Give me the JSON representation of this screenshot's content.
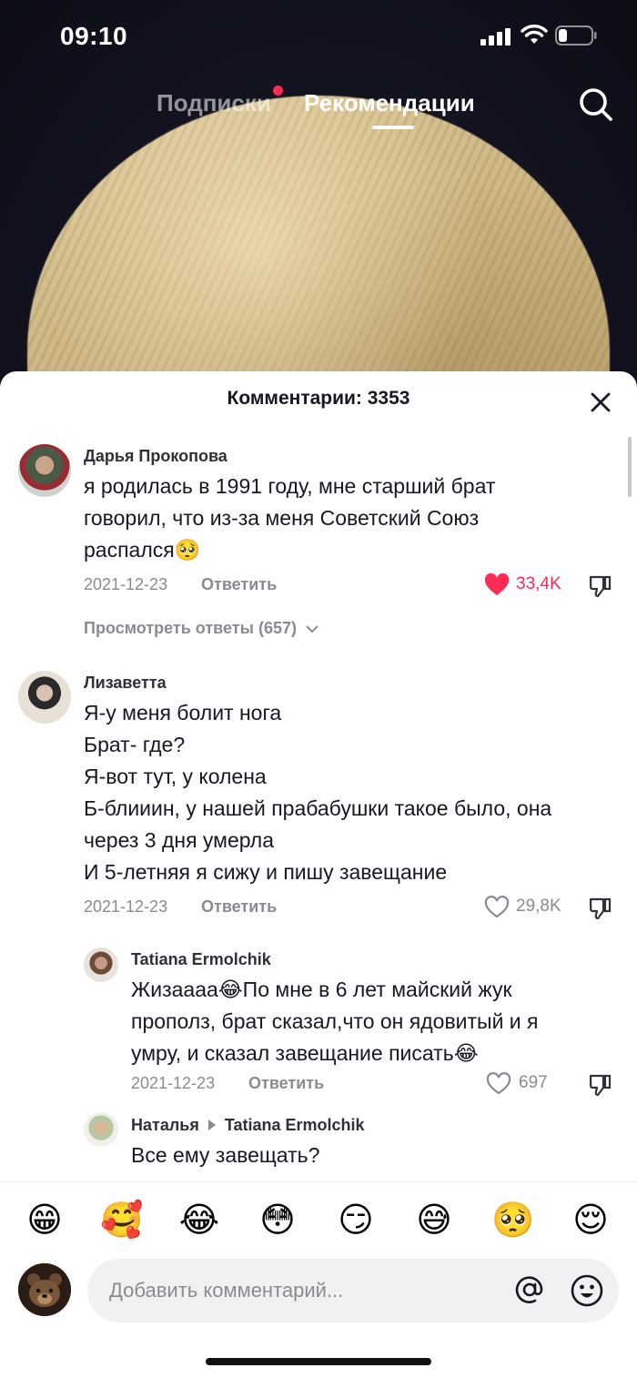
{
  "status_bar": {
    "time": "09:10"
  },
  "top_tabs": {
    "following": "Подписки",
    "for_you": "Рекомендации"
  },
  "sheet": {
    "title": "Комментарии: 3353"
  },
  "comments": [
    {
      "author": "Дарья Прокопова",
      "lines": [
        "я родилась в 1991 году, мне старший брат",
        "говорил, что из-за меня Советский Союз",
        "распался🥺"
      ],
      "date": "2021-12-23",
      "reply_label": "Ответить",
      "likes": "33,4K",
      "liked": true,
      "view_replies": "Просмотреть ответы (657)"
    },
    {
      "author": "Лизаветта",
      "lines": [
        "Я-у меня болит нога",
        "Брат- где?",
        "Я-вот тут, у колена",
        "Б-блииин, у нашей прабабушки такое было, она",
        "через 3 дня умерла",
        "И 5-летняя я сижу и пишу завещание"
      ],
      "date": "2021-12-23",
      "reply_label": "Ответить",
      "likes": "29,8K",
      "liked": false
    },
    {
      "author": "Tatiana Ermolchik",
      "lines": [
        "Жизаааа😂По мне в 6 лет майский жук",
        "прополз, брат сказал,что он ядовитый и я",
        "умру, и сказал завещание писать😂"
      ],
      "date": "2021-12-23",
      "reply_label": "Ответить",
      "likes": "697",
      "liked": false
    },
    {
      "author": "Наталья",
      "reply_to": "Tatiana Ermolchik",
      "lines": [
        "Все ему завещать?"
      ]
    }
  ],
  "emoji_bar": [
    "😁",
    "🥰",
    "😂",
    "😳",
    "😏",
    "😅",
    "🥺",
    "😌"
  ],
  "input": {
    "placeholder": "Добавить комментарий..."
  },
  "colors": {
    "accent": "#fe2c55",
    "text": "#161823",
    "muted": "#8a8b91"
  }
}
